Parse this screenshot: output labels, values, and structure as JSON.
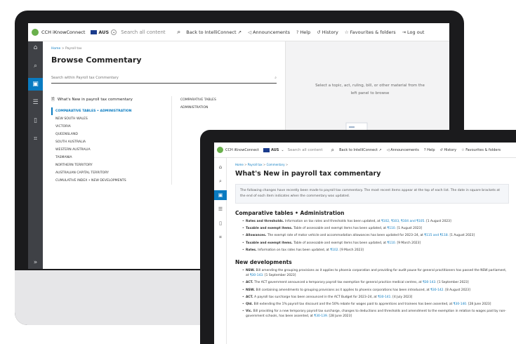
{
  "back_screen": {
    "topbar": {
      "brand": "CCH iKnowConnect",
      "region": "AUS",
      "search_placeholder": "Search all content",
      "links": [
        "Back to IntelliConnect",
        "Announcements",
        "Help",
        "History",
        "Favourites & folders",
        "Log out"
      ]
    },
    "breadcrumb": {
      "home": "Home",
      "sep": ">",
      "current": "Payroll tax"
    },
    "title": "Browse Commentary",
    "search_placeholder": "Search within Payroll tax Commentary",
    "whats_new": "What's New in payroll tax commentary",
    "list": [
      "COMPARATIVE TABLES • ADMINISTRATION",
      "NEW SOUTH WALES",
      "VICTORIA",
      "QUEENSLAND",
      "SOUTH AUSTRALIA",
      "WESTERN AUSTRALIA",
      "TASMANIA",
      "NORTHERN TERRITORY",
      "AUSTRALIAN CAPITAL TERRITORY",
      "CUMULATIVE INDEX • NEW DEVELOPMENTS"
    ],
    "col2": [
      "COMPARATIVE TABLES",
      "ADMINISTRATION"
    ],
    "hint": "Select a topic, act, ruling, bill, or other material from the left panel to browse"
  },
  "front_screen": {
    "topbar": {
      "brand": "CCH iKnowConnect",
      "region": "AUS",
      "search_placeholder": "Search all content",
      "links": [
        "Back to IntelliConnect",
        "Announcements",
        "Help",
        "History",
        "Favourites & folders"
      ]
    },
    "breadcrumb": [
      "Home",
      "Payroll tax",
      "Commentary"
    ],
    "title": "What's New in payroll tax commentary",
    "note": "The following changes have recently been made to payroll tax commentary. The most recent items appear at the top of each list. The date in square brackets at the end of each item indicates when the commentary was updated.",
    "section1": "Comparative tables • Administration",
    "section1_items": [
      {
        "lead": "Rates and thresholds.",
        "text": "Information on tax rates and thresholds has been updated, at ",
        "refs": "¶102, ¶103, ¶104 and ¶105.",
        "date": "[1 August 2023]"
      },
      {
        "lead": "Taxable and exempt items.",
        "text": "Table of assessable and exempt items has been updated, at ",
        "refs": "¶110.",
        "date": "[1 August 2023]"
      },
      {
        "lead": "Allowances.",
        "text": "The exempt rate of motor vehicle and accommodation allowances has been updated for 2023–24, at ",
        "refs": "¶115 and ¶118.",
        "date": "[1 August 2023]"
      },
      {
        "lead": "Taxable and exempt items.",
        "text": "Table of assessable and exempt items has been updated, at ",
        "refs": "¶110.",
        "date": "[9 March 2023]"
      },
      {
        "lead": "Rates.",
        "text": "Information on tax rates has been updated, at ",
        "refs": "¶102.",
        "date": "[9 March 2023]"
      }
    ],
    "section2": "New developments",
    "section2_items": [
      {
        "lead": "NSW.",
        "text": "Bill amending the grouping provisions as it applies to phoenix corporation and providing for audit pause for general practitioners has passed the NSW parliament, at ",
        "refs": "¶30-143.",
        "date": "[1 September 2023]"
      },
      {
        "lead": "ACT.",
        "text": "The ACT government announced a temporary payroll tax exemption for general practice medical centres, at ",
        "refs": "¶30-143.",
        "date": "[1 September 2023]"
      },
      {
        "lead": "NSW.",
        "text": "Bill containing amendments to grouping provisions as it applies to phoenix corporations has been introduced, at ",
        "refs": "¶30-142.",
        "date": "[8 August 2023]"
      },
      {
        "lead": "ACT.",
        "text": "A payroll tax surcharge has been announced in the ACT Budget for 2023–24, at ",
        "refs": "¶30-141.",
        "date": "[4 July 2023]"
      },
      {
        "lead": "Qld.",
        "text": "Bill extending the 1% payroll tax discount and the 50% rebate for wages paid to apprentices and trainees has been assented, at ",
        "refs": "¶30-140.",
        "date": "[28 June 2023]"
      },
      {
        "lead": "Vic.",
        "text": "Bill providing for a new temporary payroll tax surcharge, changes to deductions and thresholds and amendment to the exemption in relation to wages paid by non-government schools, has been assented, at ",
        "refs": "¶30-139.",
        "date": "[28 June 2023]"
      }
    ]
  },
  "colors": {
    "accent": "#0a7bc1",
    "rail": "#3f4146",
    "bezel": "#1b1b1d",
    "brand_green": "#6ab04c"
  }
}
